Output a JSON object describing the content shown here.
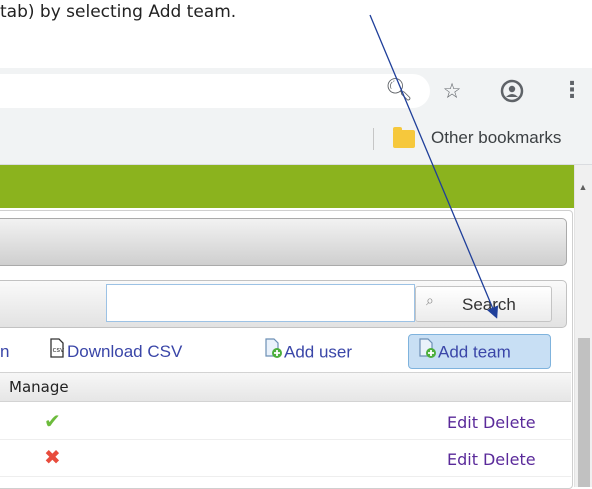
{
  "caption": "tab) by selecting Add team.",
  "browser": {
    "icons": [
      "zoom-icon",
      "star-icon",
      "account-icon",
      "menu-dots-icon"
    ],
    "bookmarks_other_label": "Other bookmarks"
  },
  "search": {
    "placeholder": "",
    "button_label": "Search"
  },
  "toolbar": {
    "cut_label": "n",
    "download_csv_label": "Download CSV",
    "add_user_label": "Add user",
    "add_team_label": "Add team"
  },
  "table": {
    "header_manage": "Manage",
    "rows": [
      {
        "status": "active",
        "edit_label": "Edit",
        "delete_label": "Delete"
      },
      {
        "status": "inactive",
        "edit_label": "Edit",
        "delete_label": "Delete"
      }
    ]
  },
  "colors": {
    "green_bar": "#8bb31e",
    "link": "#3a46a8",
    "action_link": "#5a2a9a",
    "check_green": "#6cbb3c",
    "cross_red": "#e84c3d",
    "arrow": "#1f3f9a"
  }
}
